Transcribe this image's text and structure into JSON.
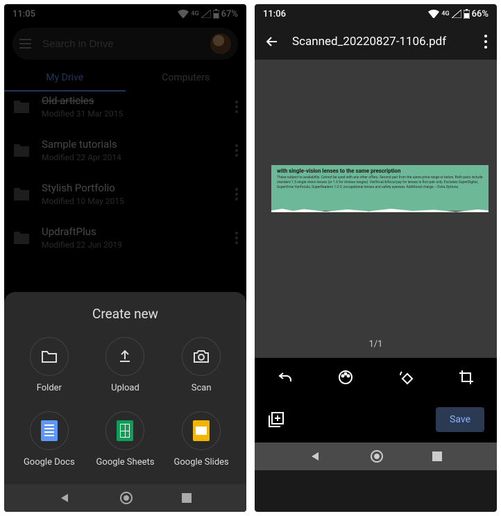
{
  "left": {
    "status": {
      "time": "11:05",
      "net": "4G",
      "battery": "67%"
    },
    "search": {
      "placeholder": "Search in Drive"
    },
    "tabs": {
      "active": "My Drive",
      "other": "Computers"
    },
    "files": [
      {
        "name": "Old articles",
        "mod": "Modified 31 Mar 2015"
      },
      {
        "name": "Sample tutorials",
        "mod": "Modified 22 Apr 2014"
      },
      {
        "name": "Stylish Portfolio",
        "mod": "Modified 10 May 2015"
      },
      {
        "name": "UpdraftPlus",
        "mod": "Modified 22 Jun 2019"
      }
    ],
    "sheet": {
      "title": "Create new",
      "items": [
        "Folder",
        "Upload",
        "Scan",
        "Google Docs",
        "Google Sheets",
        "Google Slides"
      ]
    }
  },
  "right": {
    "status": {
      "time": "11:06",
      "net": "4G",
      "battery": "66%"
    },
    "title": "Scanned_20220827-1106.pdf",
    "slip": {
      "l1": "with single-vision lenses to the same prescription",
      "l2": "These subject to availability. Cannot be used with any other offers. Second pair from the same price range or below. Both pairs include standard 1.5 single vision lenses (or 1.6 for rimless ranges). Varifocal/bifocal pay for lenses in first pair only. Excludes SuperDigital, SuperDrive Varifocals, SuperReaders 1-2-3, occupational lenses and safety eyewear. Additional charge – Extra Options."
    },
    "pager": "1/1",
    "save": "Save"
  }
}
